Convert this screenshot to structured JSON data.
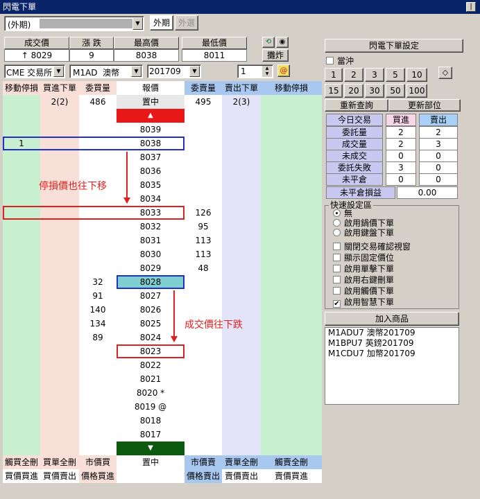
{
  "window": {
    "title": "閃電下單",
    "title_button": "|"
  },
  "account": {
    "value": "(外期)",
    "masked": ""
  },
  "tabs": {
    "foreign_futures": "外期",
    "foreign_options": "外選"
  },
  "quote": {
    "headers": [
      "成交價",
      "漲 跌",
      "最高價",
      "最低價"
    ],
    "values": [
      "↑ 8029",
      "9",
      "8038",
      "8011"
    ]
  },
  "tools": {
    "flat_button": "攤炸"
  },
  "selectors": {
    "exchange": "CME 交易所",
    "product": "M1AD  澳幣",
    "month": "201709",
    "qty": "1"
  },
  "ladder_headers": [
    "移動停損",
    "買進下單",
    "委買量",
    "報價",
    "委賣量",
    "賣出下單",
    "移動停損"
  ],
  "summary_row": {
    "buy_orders": "2(2)",
    "bid_qty": "486",
    "center": "置中",
    "ask_qty": "495",
    "sell_orders": "2(3)"
  },
  "up_arrow": "▲",
  "down_arrow": "▼",
  "rows": [
    {
      "stop_buy": "",
      "bid": "",
      "price": "8039",
      "ask": ""
    },
    {
      "stop_buy": "1",
      "bid": "",
      "price": "8038",
      "ask": ""
    },
    {
      "stop_buy": "",
      "bid": "",
      "price": "8037",
      "ask": ""
    },
    {
      "stop_buy": "",
      "bid": "",
      "price": "8036",
      "ask": ""
    },
    {
      "stop_buy": "",
      "bid": "",
      "price": "8035",
      "ask": ""
    },
    {
      "stop_buy": "",
      "bid": "",
      "price": "8034",
      "ask": ""
    },
    {
      "stop_buy": "",
      "bid": "",
      "price": "8033",
      "ask": "126"
    },
    {
      "stop_buy": "",
      "bid": "",
      "price": "8032",
      "ask": "95"
    },
    {
      "stop_buy": "",
      "bid": "",
      "price": "8031",
      "ask": "113"
    },
    {
      "stop_buy": "",
      "bid": "",
      "price": "8030",
      "ask": "113"
    },
    {
      "stop_buy": "",
      "bid": "",
      "price": "8029",
      "ask": "48"
    },
    {
      "stop_buy": "",
      "bid": "32",
      "price": "8028",
      "ask": ""
    },
    {
      "stop_buy": "",
      "bid": "91",
      "price": "8027",
      "ask": ""
    },
    {
      "stop_buy": "",
      "bid": "140",
      "price": "8026",
      "ask": ""
    },
    {
      "stop_buy": "",
      "bid": "134",
      "price": "8025",
      "ask": ""
    },
    {
      "stop_buy": "",
      "bid": "89",
      "price": "8024",
      "ask": ""
    },
    {
      "stop_buy": "",
      "bid": "",
      "price": "8023",
      "ask": ""
    },
    {
      "stop_buy": "",
      "bid": "",
      "price": "8022",
      "ask": ""
    },
    {
      "stop_buy": "",
      "bid": "",
      "price": "8021",
      "ask": ""
    },
    {
      "stop_buy": "",
      "bid": "",
      "price": "8020 *",
      "ask": ""
    },
    {
      "stop_buy": "",
      "bid": "",
      "price": "8019 @",
      "ask": ""
    },
    {
      "stop_buy": "",
      "bid": "",
      "price": "8018",
      "ask": ""
    },
    {
      "stop_buy": "",
      "bid": "",
      "price": "8017",
      "ask": ""
    }
  ],
  "annotations": {
    "stop_move": "停損價也往下移",
    "trade_down": "成交價往下跌"
  },
  "bottom_row1": [
    "觸買全刪",
    "買單全刪",
    "市價買",
    "置中",
    "市價賣",
    "賣單全刪",
    "觸賣全刪"
  ],
  "bottom_row2": [
    "買價買進",
    "買價賣出",
    "價格買進",
    "",
    "價格賣出",
    "賣價賣出",
    "賣價買進"
  ],
  "right": {
    "settings_button": "閃電下單設定",
    "day_trade": "當沖",
    "qty_buttons_row1": [
      "1",
      "2",
      "3",
      "5",
      "10"
    ],
    "qty_buttons_row2": [
      "15",
      "20",
      "30",
      "50",
      "100"
    ],
    "requery": "重新查詢",
    "refresh_position": "更新部位",
    "stats_headers": [
      "今日交易",
      "買進",
      "賣出"
    ],
    "stats": [
      {
        "label": "委託量",
        "buy": "2",
        "sell": "2"
      },
      {
        "label": "成交量",
        "buy": "2",
        "sell": "3"
      },
      {
        "label": "未成交",
        "buy": "0",
        "sell": "0"
      },
      {
        "label": "委託失敗",
        "buy": "3",
        "sell": "0"
      },
      {
        "label": "未平倉",
        "buy": "0",
        "sell": "0"
      }
    ],
    "unrealized_label": "未平倉損益",
    "unrealized_value": "0.00",
    "quick_title": "快速設定區",
    "radios": [
      "無",
      "啟用鍋價下單",
      "啟用鍵盤下單"
    ],
    "checks": [
      "關閉交易確認視窗",
      "顯示固定價位",
      "啟用單擊下單",
      "啟用右鍵刪單",
      "啟用觸價下單",
      "啟用智慧下單"
    ],
    "checked": [
      false,
      false,
      false,
      false,
      false,
      true
    ],
    "add_product": "加入商品",
    "products": [
      "M1ADU7 澳幣201709",
      "M1BPU7 英鎊201709",
      "M1CDU7 加幣201709"
    ]
  }
}
